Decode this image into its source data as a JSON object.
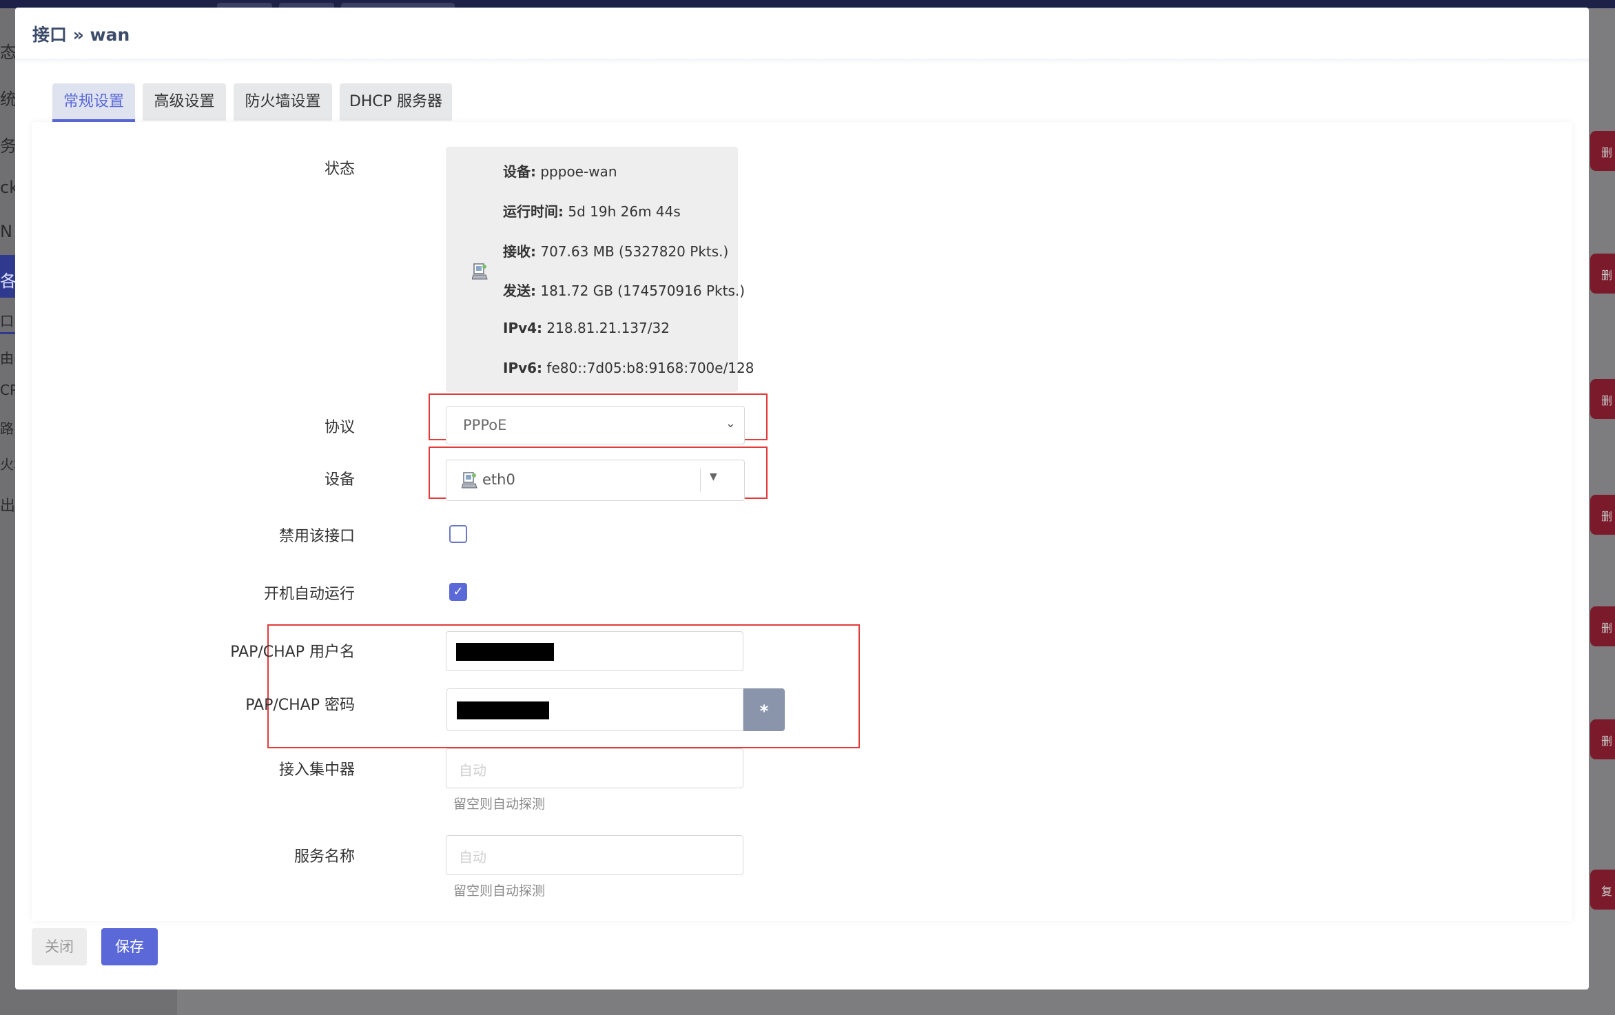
{
  "background": {
    "sidebar_fragments": [
      "态",
      "统",
      "务",
      "ck",
      "N",
      "各",
      "口",
      "由",
      "CP",
      "路",
      "火墙",
      "出"
    ],
    "right_button_glyph": "删",
    "right_button_last_glyph": "复"
  },
  "modal": {
    "title": "接口 » wan",
    "tabs": [
      {
        "label": "常规设置",
        "active": true
      },
      {
        "label": "高级设置",
        "active": false
      },
      {
        "label": "防火墙设置",
        "active": false
      },
      {
        "label": "DHCP 服务器",
        "active": false
      }
    ],
    "status": {
      "label": "状态",
      "icon": "network-port-icon",
      "rows": [
        {
          "key": "设备:",
          "value": " pppoe-wan"
        },
        {
          "key": "运行时间:",
          "value": " 5d 19h 26m 44s"
        },
        {
          "key": "接收:",
          "value": " 707.63 MB (5327820 Pkts.)"
        },
        {
          "key": "发送:",
          "value": " 181.72 GB (174570916 Pkts.)"
        },
        {
          "key": "IPv4:",
          "value": " 218.81.21.137/32"
        },
        {
          "key": "IPv6:",
          "value": " fe80::7d05:b8:9168:700e/128"
        }
      ]
    },
    "protocol": {
      "label": "协议",
      "value": "PPPoE"
    },
    "device": {
      "label": "设备",
      "value": "eth0"
    },
    "disable_iface": {
      "label": "禁用该接口",
      "checked": false
    },
    "auto_start": {
      "label": "开机自动运行",
      "checked": true
    },
    "username": {
      "label": "PAP/CHAP 用户名",
      "value": ""
    },
    "password": {
      "label": "PAP/CHAP 密码",
      "value": "",
      "reveal_label": "*"
    },
    "ac": {
      "label": "接入集中器",
      "placeholder": "自动",
      "hint": "留空则自动探测"
    },
    "service": {
      "label": "服务名称",
      "placeholder": "自动",
      "hint": "留空则自动探测"
    },
    "buttons": {
      "close": "关闭",
      "save": "保存"
    },
    "colors": {
      "accent": "#5a68d8",
      "highlight": "#e33a3a"
    }
  }
}
